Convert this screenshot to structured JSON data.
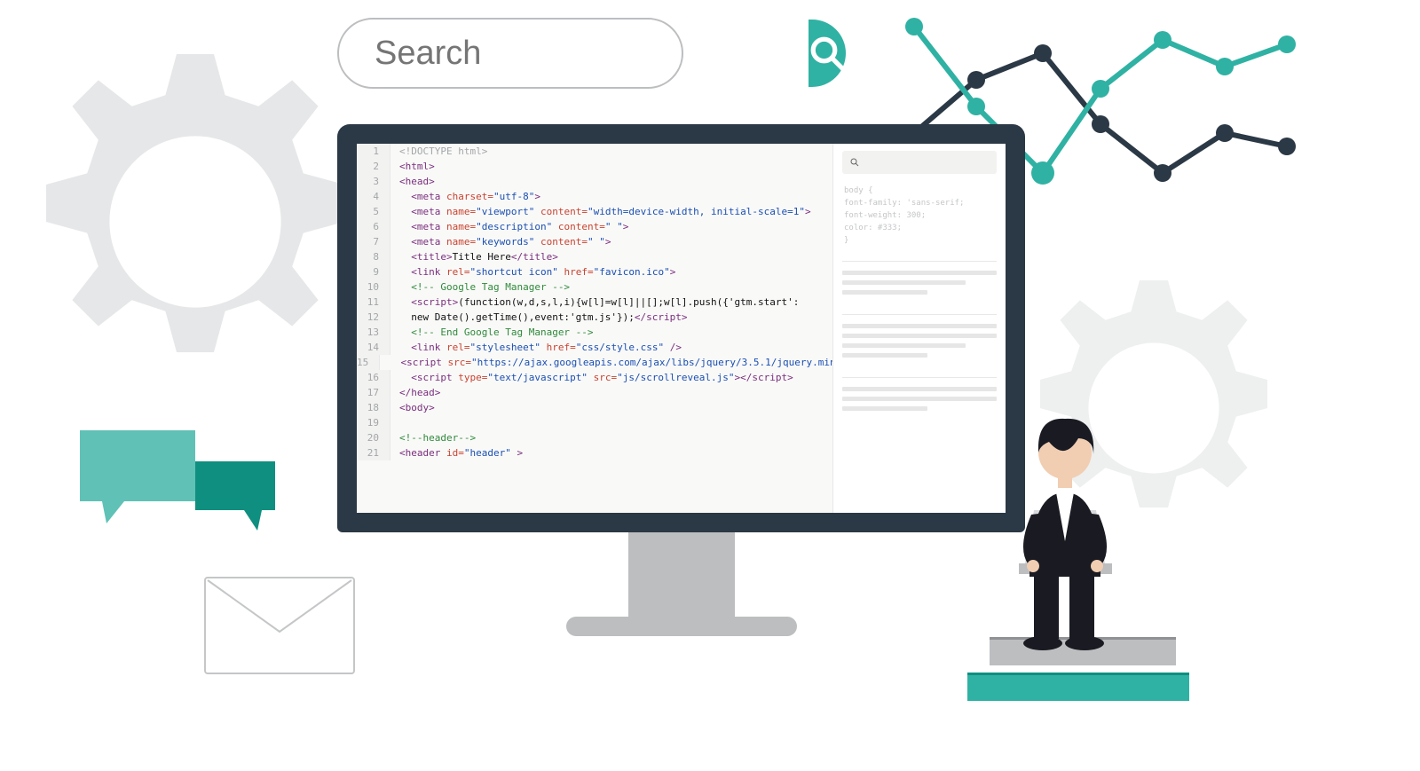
{
  "search": {
    "placeholder": "Search"
  },
  "code": {
    "lines": [
      {
        "n": 1,
        "html": "<span class='c-gray'>&lt;!DOCTYPE html&gt;</span>"
      },
      {
        "n": 2,
        "html": "<span class='c-tag'>&lt;html&gt;</span>"
      },
      {
        "n": 3,
        "html": "<span class='c-tag'>&lt;head&gt;</span>"
      },
      {
        "n": 4,
        "html": "  <span class='c-tag'>&lt;meta</span> <span class='c-attr'>charset=</span><span class='c-str'>\"utf-8\"</span><span class='c-tag'>&gt;</span>"
      },
      {
        "n": 5,
        "html": "  <span class='c-tag'>&lt;meta</span> <span class='c-attr'>name=</span><span class='c-str'>\"viewport\"</span> <span class='c-attr'>content=</span><span class='c-str'>\"width=device-width, initial-scale=1\"</span><span class='c-tag'>&gt;</span>"
      },
      {
        "n": 6,
        "html": "  <span class='c-tag'>&lt;meta</span> <span class='c-attr'>name=</span><span class='c-str'>\"description\"</span> <span class='c-attr'>content=</span><span class='c-str'>\" \"</span><span class='c-tag'>&gt;</span>"
      },
      {
        "n": 7,
        "html": "  <span class='c-tag'>&lt;meta</span> <span class='c-attr'>name=</span><span class='c-str'>\"keywords\"</span> <span class='c-attr'>content=</span><span class='c-str'>\" \"</span><span class='c-tag'>&gt;</span>"
      },
      {
        "n": 8,
        "html": "  <span class='c-tag'>&lt;title&gt;</span><span class='c-body'>Title Here</span><span class='c-tag'>&lt;/title&gt;</span>"
      },
      {
        "n": 9,
        "html": "  <span class='c-tag'>&lt;link</span> <span class='c-attr'>rel=</span><span class='c-str'>\"shortcut icon\"</span> <span class='c-attr'>href=</span><span class='c-str'>\"favicon.ico\"</span><span class='c-tag'>&gt;</span>"
      },
      {
        "n": 10,
        "html": "  <span class='c-cmt'>&lt;!-- Google Tag Manager --&gt;</span>"
      },
      {
        "n": 11,
        "html": "  <span class='c-tag'>&lt;script&gt;</span><span class='c-body'>(function(w,d,s,l,i){w[l]=w[l]||[];w[l].push({'gtm.start':</span>"
      },
      {
        "n": 12,
        "html": "  <span class='c-body'>new Date().getTime(),event:'gtm.js'});</span><span class='c-tag'>&lt;/script&gt;</span>"
      },
      {
        "n": 13,
        "html": "  <span class='c-cmt'>&lt;!-- End Google Tag Manager --&gt;</span>"
      },
      {
        "n": 14,
        "html": "  <span class='c-tag'>&lt;link</span> <span class='c-attr'>rel=</span><span class='c-str'>\"stylesheet\"</span> <span class='c-attr'>href=</span><span class='c-str'>\"css/style.css\"</span> <span class='c-tag'>/&gt;</span>"
      },
      {
        "n": 15,
        "html": "  <span class='c-tag'>&lt;script</span> <span class='c-attr'>src=</span><span class='c-str'>\"https://ajax.googleapis.com/ajax/libs/jquery/3.5.1/jquery.min.js\"</span><span class='c-tag'>&gt;&lt;/script&gt;</span>"
      },
      {
        "n": 16,
        "html": "  <span class='c-tag'>&lt;script</span> <span class='c-attr'>type=</span><span class='c-str'>\"text/javascript\"</span> <span class='c-attr'>src=</span><span class='c-str'>\"js/scrollreveal.js\"</span><span class='c-tag'>&gt;&lt;/script&gt;</span>"
      },
      {
        "n": 17,
        "html": "<span class='c-tag'>&lt;/head&gt;</span>"
      },
      {
        "n": 18,
        "html": "<span class='c-tag'>&lt;body&gt;</span>"
      },
      {
        "n": 19,
        "html": ""
      },
      {
        "n": 20,
        "html": "<span class='c-cmt'>&lt;!--header--&gt;</span>"
      },
      {
        "n": 21,
        "html": "<span class='c-tag'>&lt;header</span> <span class='c-attr'>id=</span><span class='c-str'>\"header\"</span> <span class='c-tag'>&gt;</span>"
      }
    ]
  },
  "css_snippet": {
    "l1": "body {",
    "l2": "  font-family: 'sans-serif;",
    "l3": "  font-weight: 300;",
    "l4": "  color: #333;",
    "l5": "}"
  },
  "colors": {
    "teal": "#2fb2a3",
    "teal_dark": "#0f8f80",
    "navy": "#2b3845",
    "gray_light": "#e6e6e6",
    "gray": "#bcbec0"
  }
}
